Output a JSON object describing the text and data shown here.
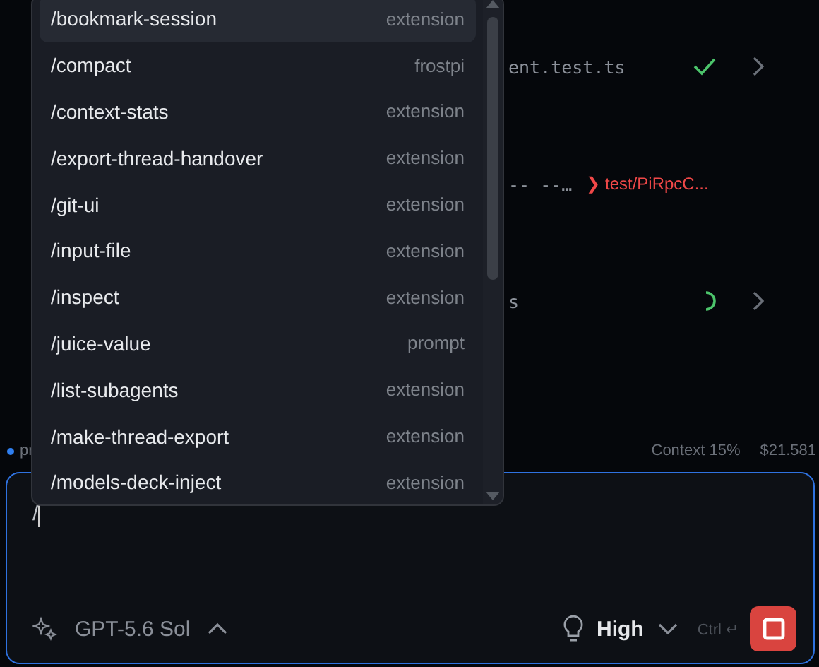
{
  "background_rows": [
    {
      "path": "ent.test.ts",
      "kind": "passed"
    },
    {
      "path": "-- --…",
      "branch": "❯ test/PiRpcC...",
      "kind": "failed"
    },
    {
      "path": "s",
      "kind": "running"
    }
  ],
  "status_bar": {
    "label": "pr",
    "context": "Context 15%",
    "cost": "$21.581"
  },
  "command_menu": {
    "items": [
      {
        "command": "/bookmark-session",
        "source": "extension",
        "selected": true
      },
      {
        "command": "/compact",
        "source": "frostpi",
        "selected": false
      },
      {
        "command": "/context-stats",
        "source": "extension",
        "selected": false
      },
      {
        "command": "/export-thread-handover",
        "source": "extension",
        "selected": false
      },
      {
        "command": "/git-ui",
        "source": "extension",
        "selected": false
      },
      {
        "command": "/input-file",
        "source": "extension",
        "selected": false
      },
      {
        "command": "/inspect",
        "source": "extension",
        "selected": false
      },
      {
        "command": "/juice-value",
        "source": "prompt",
        "selected": false
      },
      {
        "command": "/list-subagents",
        "source": "extension",
        "selected": false
      },
      {
        "command": "/make-thread-export",
        "source": "extension",
        "selected": false
      },
      {
        "command": "/models-deck-inject",
        "source": "extension",
        "selected": false
      }
    ]
  },
  "composer": {
    "value": "/",
    "model": "GPT-5.6 Sol",
    "effort": "High",
    "shortcut": "Ctrl ↵"
  }
}
